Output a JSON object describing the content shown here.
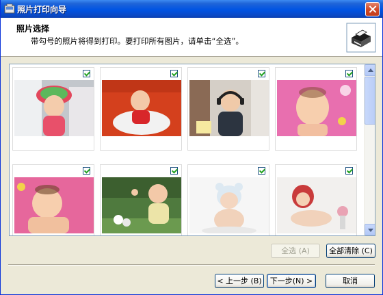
{
  "window": {
    "title": "照片打印向导"
  },
  "header": {
    "title": "照片选择",
    "subtitle": "带勾号的照片将得到打印。要打印所有图片，请单击“全选”。"
  },
  "photos": [
    {
      "checked": true,
      "bg": "#bcc3cc",
      "accent": "#e2475c"
    },
    {
      "checked": true,
      "bg": "#d9421e",
      "accent": "#ffffff"
    },
    {
      "checked": true,
      "bg": "#cfc8c0",
      "accent": "#3a3a3a"
    },
    {
      "checked": true,
      "bg": "#e86faf",
      "accent": "#f7c9a6"
    },
    {
      "checked": true,
      "bg": "#e6679c",
      "accent": "#f7c9a6"
    },
    {
      "checked": true,
      "bg": "#4f7a3e",
      "accent": "#ece4a8"
    },
    {
      "checked": true,
      "bg": "#f4f4f4",
      "accent": "#f1d2bb"
    },
    {
      "checked": true,
      "bg": "#f2f0ee",
      "accent": "#c93b3b"
    }
  ],
  "buttons": {
    "select_all": "全选",
    "select_all_key": "(A)",
    "clear_all": "全部清除",
    "clear_all_key": "(C)",
    "back": "< 上一步",
    "back_key": "(B)",
    "next": "下一步",
    "next_key": "(N)",
    "next_suffix": ">",
    "cancel": "取消"
  },
  "colors": {
    "titlebar": "#0054e3",
    "check": "#21a121",
    "frame": "#ece9d8"
  }
}
